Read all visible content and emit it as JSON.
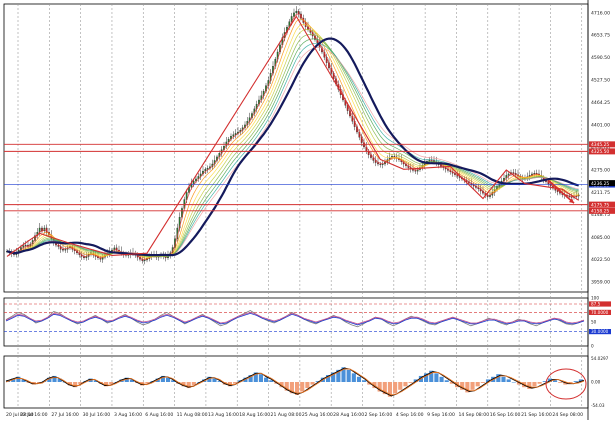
{
  "chart_data": [
    {
      "type": "candlestick",
      "panel": "price",
      "x_ticks": [
        "22 Jul 16:00",
        "27 Jul 16:00",
        "30 Jul 16:00",
        "3 Aug 16:00",
        "6 Aug 16:00",
        "11 Aug 08:00",
        "13 Aug 16:00",
        "18 Aug 16:00",
        "21 Aug 08:00",
        "25 Aug 16:00",
        "28 Aug 16:00",
        "2 Sep 16:00",
        "4 Sep 16:00",
        "9 Sep 16:00",
        "14 Sep 08:00",
        "16 Sep 16:00",
        "21 Sep 16:00",
        "24 Sep 08:00"
      ],
      "x_start_label": "20 Jul 08:00",
      "y_ticks": [
        3959.0,
        4022.5,
        4085.0,
        4148.75,
        4211.75,
        4275.0,
        4338.0,
        4401.0,
        4464.25,
        4527.5,
        4590.5,
        4653.75,
        4716.0
      ],
      "ylim": [
        3930,
        4740
      ],
      "close": [
        4045,
        4040,
        4038,
        4035,
        4040,
        4048,
        4055,
        4060,
        4062,
        4058,
        4065,
        4075,
        4088,
        4098,
        4110,
        4102,
        4110,
        4098,
        4090,
        4080,
        4070,
        4062,
        4058,
        4050,
        4048,
        4050,
        4054,
        4058,
        4050,
        4046,
        4040,
        4035,
        4030,
        4026,
        4030,
        4036,
        4040,
        4034,
        4030,
        4026,
        4022,
        4028,
        4034,
        4038,
        4042,
        4048,
        4054,
        4048,
        4044,
        4040,
        4036,
        4033,
        4035,
        4038,
        4040,
        4034,
        4028,
        4022,
        4018,
        4020,
        4024,
        4030,
        4034,
        4032,
        4028,
        4030,
        4034,
        4030,
        4026,
        4032,
        4040,
        4055,
        4080,
        4110,
        4140,
        4165,
        4190,
        4210,
        4225,
        4235,
        4242,
        4248,
        4255,
        4262,
        4270,
        4275,
        4278,
        4282,
        4290,
        4300,
        4310,
        4320,
        4330,
        4340,
        4352,
        4360,
        4368,
        4372,
        4376,
        4380,
        4385,
        4392,
        4400,
        4410,
        4420,
        4432,
        4445,
        4458,
        4470,
        4482,
        4495,
        4510,
        4525,
        4545,
        4565,
        4585,
        4605,
        4625,
        4645,
        4660,
        4675,
        4690,
        4705,
        4715,
        4720,
        4712,
        4700,
        4688,
        4676,
        4668,
        4660,
        4650,
        4640,
        4630,
        4618,
        4605,
        4590,
        4575,
        4560,
        4545,
        4530,
        4515,
        4500,
        4485,
        4470,
        4455,
        4440,
        4425,
        4410,
        4395,
        4380,
        4365,
        4350,
        4338,
        4326,
        4316,
        4308,
        4300,
        4294,
        4290,
        4288,
        4290,
        4295,
        4302,
        4308,
        4312,
        4310,
        4306,
        4302,
        4296,
        4290,
        4285,
        4280,
        4276,
        4272,
        4270,
        4274,
        4280,
        4286,
        4292,
        4298,
        4302,
        4300,
        4296,
        4292,
        4288,
        4284,
        4280,
        4276,
        4272,
        4268,
        4264,
        4260,
        4256,
        4252,
        4248,
        4244,
        4240,
        4236,
        4232,
        4228,
        4224,
        4220,
        4214,
        4208,
        4202,
        4198,
        4202,
        4210,
        4218,
        4226,
        4234,
        4242,
        4250,
        4258,
        4262,
        4266,
        4264,
        4260,
        4256,
        4252,
        4248,
        4250,
        4254,
        4258,
        4262,
        4264,
        4262,
        4258,
        4252,
        4246,
        4240,
        4234,
        4228,
        4222,
        4216,
        4212,
        4208,
        4204,
        4202,
        4200,
        4198,
        4196,
        4198,
        4200,
        4203
      ],
      "overlays": [
        "ema-ribbon",
        "sma-line-navy"
      ],
      "horizontal_levels": [
        {
          "y": 4345.25,
          "label": "4345.25",
          "color": "#d32f2f"
        },
        {
          "y": 4325.5,
          "label": "4325.50",
          "color": "#d32f2f"
        },
        {
          "y": 4232.25,
          "label": "4232.25",
          "color": "#1a3ad1"
        },
        {
          "y": 4175.75,
          "label": "4175.75",
          "color": "#d32f2f"
        },
        {
          "y": 4158.25,
          "label": "4158.25",
          "color": "#d32f2f"
        }
      ],
      "current_price": 4236.25
    },
    {
      "type": "line",
      "panel": "oscillator",
      "y_ticks": [
        "100",
        "87.5",
        "70.0000",
        "50",
        "30.0000",
        "0"
      ],
      "ylim": [
        0,
        100
      ],
      "levels": [
        87.5,
        70,
        30
      ],
      "series": [
        {
          "values": [
            55,
            62,
            70,
            66,
            58,
            48,
            52,
            60,
            72,
            68,
            60,
            52,
            46,
            50,
            58,
            64,
            56,
            48,
            52,
            60,
            66,
            58,
            50,
            44,
            48,
            56,
            64,
            70,
            62,
            54,
            46,
            52,
            60,
            66,
            58,
            50,
            42,
            46,
            54,
            62,
            68,
            74,
            66,
            58,
            52,
            48,
            54,
            62,
            70,
            64,
            56,
            50,
            46,
            52,
            58,
            64,
            58,
            50,
            44,
            40,
            46,
            54,
            60,
            56,
            48,
            42,
            48,
            56,
            62,
            58,
            52,
            46,
            44,
            50,
            56,
            60,
            54,
            48,
            42,
            46,
            52,
            58,
            54,
            48,
            44,
            50,
            56,
            52,
            46,
            42,
            48,
            54,
            58,
            52,
            46,
            44,
            48,
            54
          ],
          "color": "#808080"
        },
        {
          "values": [
            52,
            58,
            64,
            62,
            56,
            50,
            52,
            58,
            66,
            64,
            58,
            52,
            48,
            50,
            56,
            60,
            56,
            50,
            52,
            58,
            62,
            58,
            52,
            48,
            50,
            54,
            60,
            64,
            60,
            54,
            48,
            52,
            58,
            62,
            58,
            52,
            46,
            48,
            54,
            60,
            64,
            68,
            64,
            58,
            54,
            50,
            54,
            60,
            66,
            62,
            56,
            52,
            48,
            52,
            56,
            60,
            58,
            52,
            48,
            44,
            48,
            52,
            58,
            56,
            50,
            46,
            48,
            54,
            58,
            58,
            54,
            48,
            46,
            50,
            54,
            58,
            54,
            50,
            46,
            46,
            50,
            54,
            54,
            50,
            46,
            48,
            52,
            52,
            48,
            46,
            48,
            52,
            56,
            54,
            48,
            46,
            48,
            52
          ],
          "color": "#1a3ad1"
        },
        {
          "values": [
            54,
            60,
            66,
            64,
            58,
            52,
            54,
            60,
            68,
            66,
            60,
            54,
            50,
            52,
            58,
            62,
            58,
            52,
            54,
            60,
            64,
            60,
            54,
            50,
            52,
            56,
            62,
            66,
            62,
            56,
            50,
            54,
            60,
            64,
            60,
            54,
            48,
            50,
            56,
            62,
            66,
            70,
            66,
            60,
            56,
            52,
            56,
            62,
            68,
            64,
            58,
            54,
            50,
            54,
            58,
            62,
            60,
            54,
            50,
            46,
            50,
            54,
            60,
            58,
            52,
            48,
            50,
            56,
            60,
            60,
            56,
            50,
            48,
            52,
            56,
            60,
            56,
            52,
            48,
            48,
            52,
            56,
            56,
            52,
            48,
            50,
            54,
            54,
            50,
            48,
            50,
            54,
            58,
            56,
            50,
            48,
            50,
            54
          ],
          "color": "#c05090"
        }
      ]
    },
    {
      "type": "bar",
      "panel": "histogram",
      "y_ticks": [
        "54.0297",
        "0.00",
        "-54.03"
      ],
      "ylim": [
        -60,
        60
      ],
      "values": [
        4,
        8,
        12,
        6,
        -2,
        -6,
        -4,
        2,
        10,
        14,
        8,
        0,
        -8,
        -12,
        -6,
        2,
        8,
        4,
        -4,
        -10,
        -6,
        0,
        6,
        10,
        6,
        -2,
        -8,
        -4,
        2,
        8,
        14,
        10,
        4,
        -4,
        -10,
        -14,
        -8,
        0,
        6,
        12,
        8,
        2,
        -6,
        -10,
        -4,
        4,
        10,
        16,
        22,
        18,
        10,
        4,
        -4,
        -12,
        -20,
        -26,
        -30,
        -22,
        -14,
        -6,
        2,
        10,
        16,
        22,
        28,
        34,
        28,
        20,
        12,
        4,
        -6,
        -14,
        -22,
        -28,
        -34,
        -26,
        -18,
        -10,
        -2,
        6,
        14,
        20,
        26,
        20,
        12,
        4,
        -4,
        -12,
        -18,
        -24,
        -18,
        -10,
        -2,
        6,
        12,
        18,
        12,
        6,
        0,
        -6,
        -12,
        -16,
        -10,
        -4,
        2,
        8,
        4,
        -2,
        -6,
        -4,
        2,
        6
      ],
      "lines": [
        {
          "values": [
            2,
            6,
            10,
            8,
            2,
            -4,
            -4,
            0,
            8,
            12,
            10,
            2,
            -6,
            -10,
            -8,
            0,
            6,
            6,
            -2,
            -8,
            -8,
            -2,
            4,
            8,
            8,
            0,
            -6,
            -6,
            0,
            6,
            12,
            12,
            6,
            -2,
            -8,
            -12,
            -10,
            -2,
            4,
            10,
            10,
            4,
            -4,
            -8,
            -6,
            2,
            8,
            14,
            20,
            20,
            12,
            6,
            -2,
            -10,
            -18,
            -24,
            -28,
            -24,
            -16,
            -8,
            0,
            8,
            14,
            20,
            26,
            32,
            30,
            22,
            14,
            6,
            -4,
            -12,
            -20,
            -26,
            -32,
            -28,
            -20,
            -12,
            -4,
            4,
            12,
            18,
            24,
            22,
            14,
            6,
            -2,
            -10,
            -16,
            -22,
            -20,
            -12,
            -4,
            4,
            10,
            16,
            14,
            8,
            2,
            -4,
            -10,
            -14,
            -12,
            -6,
            0,
            6,
            6,
            0,
            -4,
            -4,
            0,
            4
          ],
          "color": "#000000"
        },
        {
          "values": [
            0,
            4,
            8,
            8,
            4,
            -2,
            -4,
            -2,
            6,
            10,
            10,
            4,
            -4,
            -8,
            -8,
            -2,
            4,
            6,
            0,
            -6,
            -8,
            -4,
            2,
            6,
            8,
            2,
            -4,
            -6,
            -2,
            4,
            10,
            12,
            8,
            0,
            -6,
            -10,
            -10,
            -4,
            2,
            8,
            10,
            6,
            -2,
            -6,
            -6,
            0,
            6,
            12,
            18,
            20,
            14,
            8,
            0,
            -8,
            -16,
            -22,
            -26,
            -24,
            -18,
            -10,
            -2,
            6,
            12,
            18,
            24,
            30,
            30,
            24,
            16,
            8,
            -2,
            -10,
            -18,
            -24,
            -30,
            -28,
            -22,
            -14,
            -6,
            2,
            10,
            16,
            22,
            22,
            16,
            8,
            0,
            -8,
            -14,
            -20,
            -20,
            -14,
            -6,
            2,
            8,
            14,
            14,
            10,
            4,
            -2,
            -8,
            -12,
            -12,
            -8,
            -2,
            4,
            6,
            2,
            -2,
            -4,
            -2,
            2
          ],
          "color": "#e07020"
        }
      ]
    }
  ],
  "colors": {
    "up": "#2e7d32",
    "down": "#c62828",
    "navy": "#141a5c",
    "red_line": "#d32f2f",
    "blue_line": "#1a3ad1",
    "hist_pos": "#4a90d9",
    "hist_neg": "#f2a07b"
  },
  "annotations": {
    "zigzag": "red-zigzag",
    "circle": "red-ellipse-highlight"
  }
}
